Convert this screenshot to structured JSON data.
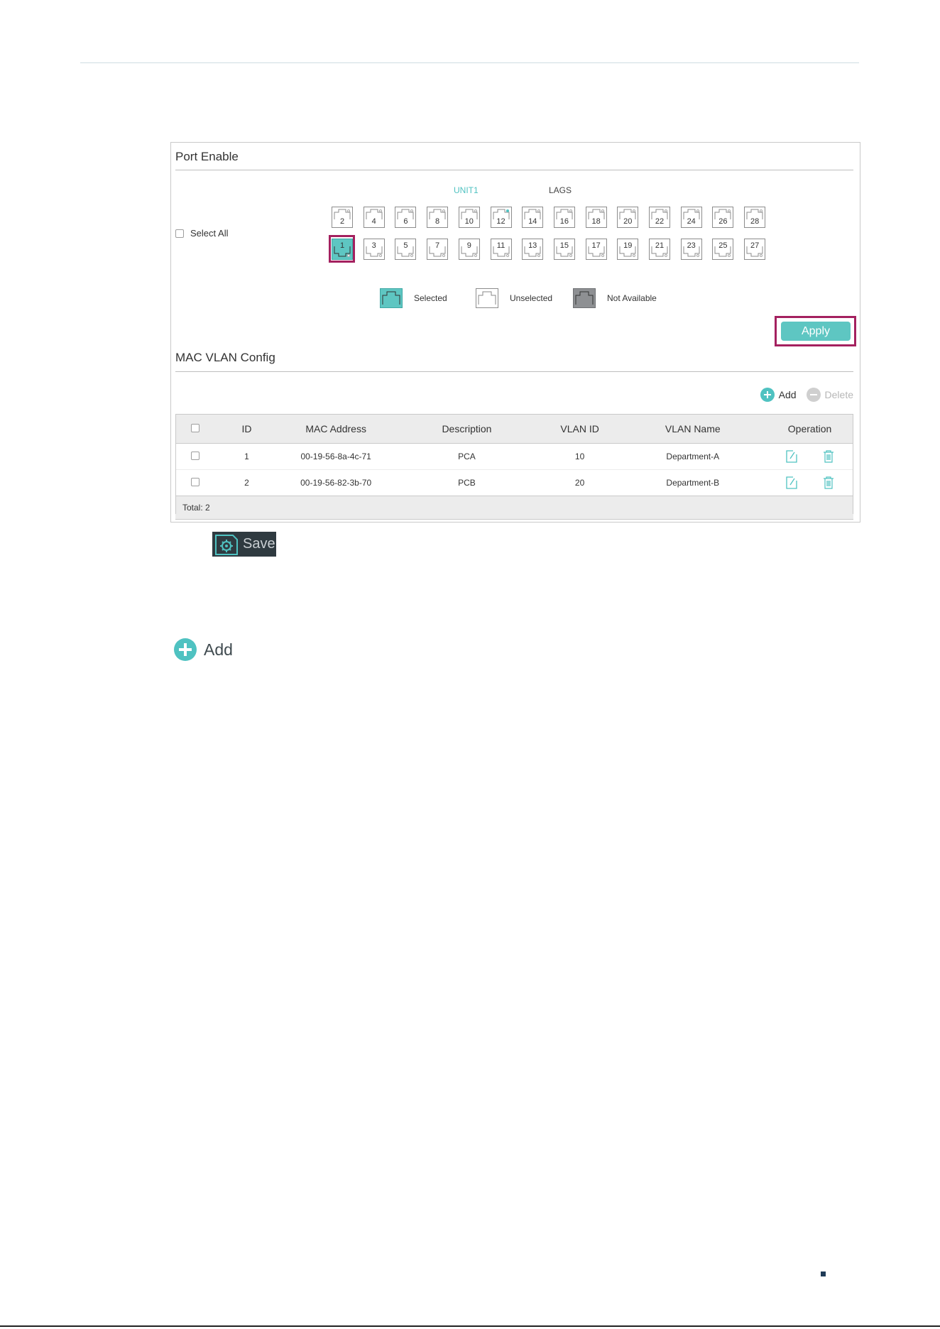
{
  "port_enable": {
    "title": "Port Enable",
    "unit_tab": "UNIT1",
    "lags_tab": "LAGS",
    "select_all_label": "Select All",
    "ports_top": [
      "2",
      "4",
      "6",
      "8",
      "10",
      "12",
      "14",
      "16",
      "18",
      "20",
      "22",
      "24",
      "26",
      "28"
    ],
    "ports_bottom": [
      "1",
      "3",
      "5",
      "7",
      "9",
      "11",
      "13",
      "15",
      "17",
      "19",
      "21",
      "23",
      "25",
      "27"
    ],
    "selected_ports": [
      "1"
    ],
    "active_link_ports": [
      "12"
    ],
    "legend": {
      "selected": "Selected",
      "unselected": "Unselected",
      "not_available": "Not Available"
    },
    "apply_label": "Apply"
  },
  "mac_vlan": {
    "title": "MAC VLAN Config",
    "add_label": "Add",
    "delete_label": "Delete",
    "columns": {
      "id": "ID",
      "mac": "MAC Address",
      "description": "Description",
      "vlan_id": "VLAN ID",
      "vlan_name": "VLAN Name",
      "operation": "Operation"
    },
    "rows": [
      {
        "id": "1",
        "mac": "00-19-56-8a-4c-71",
        "description": "PCA",
        "vlan_id": "10",
        "vlan_name": "Department-A"
      },
      {
        "id": "2",
        "mac": "00-19-56-82-3b-70",
        "description": "PCB",
        "vlan_id": "20",
        "vlan_name": "Department-B"
      }
    ],
    "total_label": "Total: 2"
  },
  "save_label": "Save",
  "add_button_label": "Add",
  "colors": {
    "accent": "#5ec6c2",
    "highlight": "#a4215f",
    "save_bg": "#2f3a40"
  },
  "icons": {
    "edit": "edit-icon",
    "delete": "trash-icon",
    "save": "save-gear-icon",
    "add": "plus-circle-icon",
    "remove": "minus-circle-icon"
  }
}
